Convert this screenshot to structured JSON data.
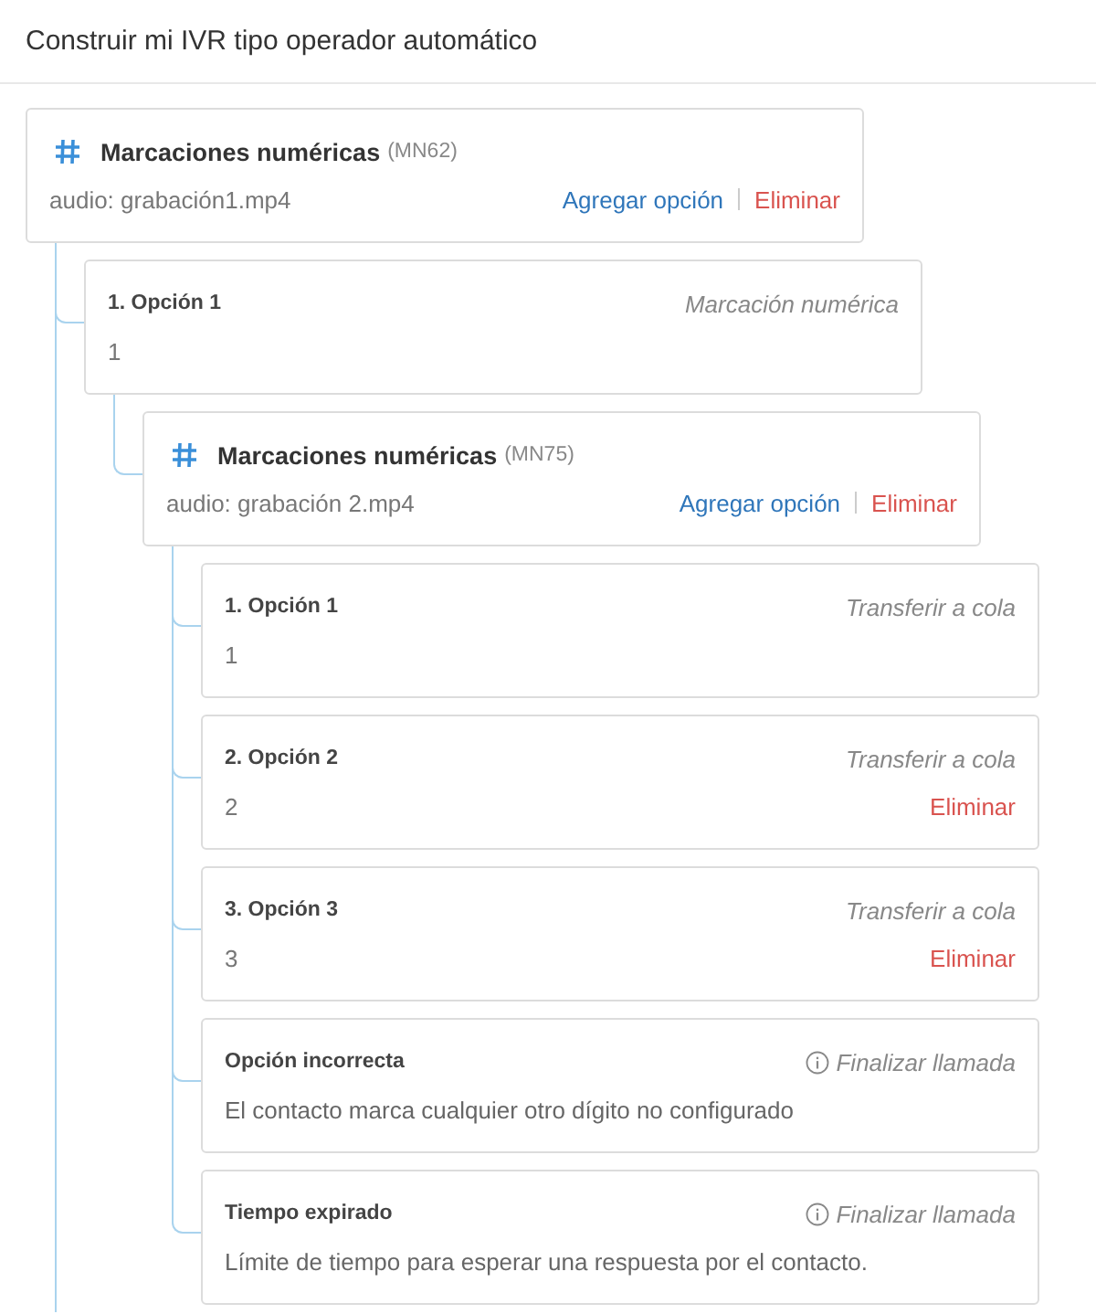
{
  "title": "Construir mi IVR tipo operador automático",
  "tree": {
    "kind": "menu",
    "name": "Marcaciones numéricas",
    "code": "(MN62)",
    "audio": "audio: grabación1.mp4",
    "add_label": "Agregar opción",
    "delete_label": "Eliminar",
    "line_continues": true,
    "children": [
      {
        "kind": "option",
        "label": "1. Opción 1",
        "action": "Marcación numérica",
        "digit": "1",
        "children": [
          {
            "kind": "menu",
            "name": "Marcaciones numéricas",
            "code": "(MN75)",
            "audio": "audio: grabación 2.mp4",
            "add_label": "Agregar opción",
            "delete_label": "Eliminar",
            "line_continues": false,
            "children": [
              {
                "kind": "option",
                "label": "1. Opción 1",
                "action": "Transferir a cola",
                "digit": "1"
              },
              {
                "kind": "option",
                "label": "2. Opción 2",
                "action": "Transferir a cola",
                "digit": "2",
                "delete_label": "Eliminar"
              },
              {
                "kind": "option",
                "label": "3. Opción 3",
                "action": "Transferir a cola",
                "digit": "3",
                "delete_label": "Eliminar"
              },
              {
                "kind": "fallback",
                "label": "Opción incorrecta",
                "action": "Finalizar llamada",
                "description": "El contacto marca cualquier otro dígito no configurado"
              },
              {
                "kind": "fallback",
                "label": "Tiempo expirado",
                "action": "Finalizar llamada",
                "description": "Límite de tiempo para esperar una respuesta por el contacto."
              }
            ]
          }
        ]
      }
    ]
  }
}
